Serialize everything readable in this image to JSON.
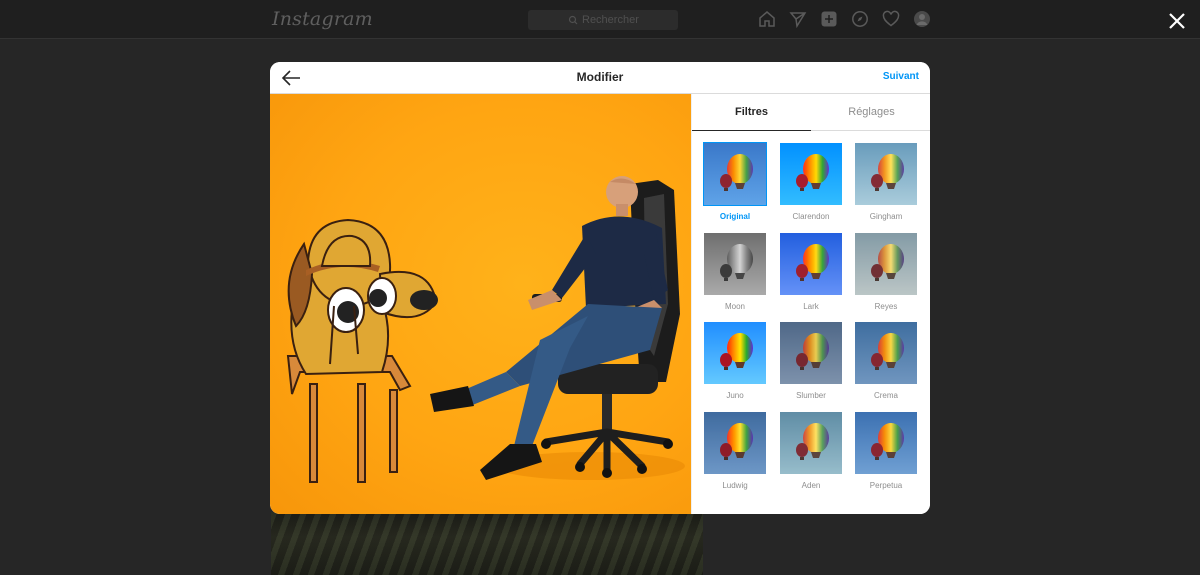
{
  "background": {
    "logo": "Instagram",
    "search_placeholder": "Rechercher",
    "nav_icons": [
      "home-icon",
      "direct-icon",
      "new-post-icon",
      "explore-icon",
      "heart-icon",
      "profile-avatar"
    ]
  },
  "modal": {
    "title": "Modifier",
    "next_label": "Suivant",
    "back_icon": "arrow-left-icon"
  },
  "tabs": [
    {
      "label": "Filtres",
      "active": true
    },
    {
      "label": "Réglages",
      "active": false
    }
  ],
  "filters": [
    {
      "name": "Original",
      "selected": true
    },
    {
      "name": "Clarendon"
    },
    {
      "name": "Gingham"
    },
    {
      "name": "Moon"
    },
    {
      "name": "Lark"
    },
    {
      "name": "Reyes"
    },
    {
      "name": "Juno"
    },
    {
      "name": "Slumber"
    },
    {
      "name": "Crema"
    },
    {
      "name": "Ludwig"
    },
    {
      "name": "Aden"
    },
    {
      "name": "Perpetua"
    }
  ],
  "colors": {
    "accent": "#0095f6",
    "overlay": "#262626",
    "photo_background": "#ffa512"
  }
}
